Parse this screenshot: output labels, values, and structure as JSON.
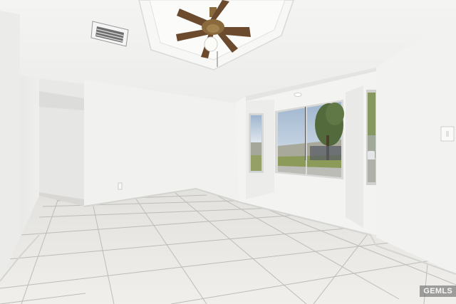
{
  "photo": {
    "subject": "empty-room-with-bay-window",
    "colors": {
      "wall": "#f1f1ef",
      "ceiling": "#f6f6f4",
      "floor": "#e6e5e1",
      "grout": "#b9b8b4",
      "sky": "#c7d5e4",
      "grass": "#8c9a5a",
      "fan_blade": "#6b4a2e",
      "fan_motor": "#8a6a3c"
    }
  },
  "watermark": {
    "text": "GEMLS"
  }
}
